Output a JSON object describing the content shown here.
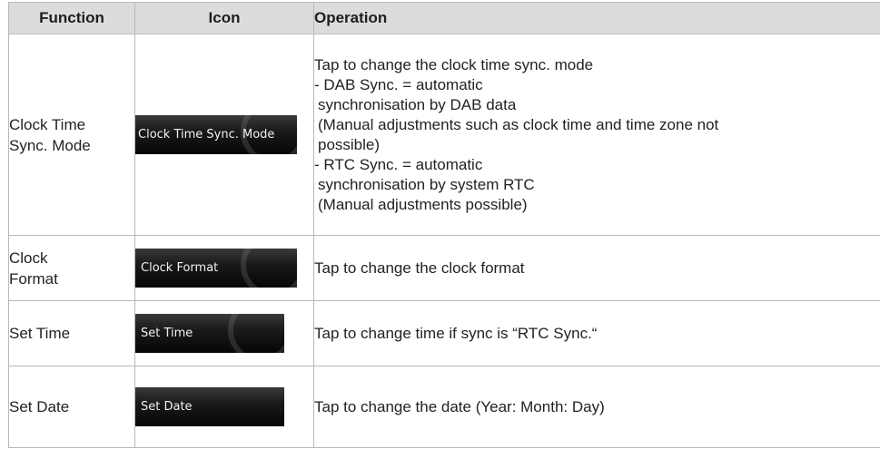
{
  "table": {
    "headers": {
      "function": "Function",
      "icon": "Icon",
      "operation": "Operation"
    },
    "rows": [
      {
        "function": [
          "Clock Time",
          "Sync. Mode"
        ],
        "icon_label": "Clock Time Sync. Mode",
        "operation": [
          "Tap to change the clock time sync. mode",
          "- DAB Sync. = automatic",
          "  synchronisation by DAB data",
          "  (Manual adjustments such as clock time and time zone not",
          "  possible)",
          "- RTC Sync. = automatic",
          "  synchronisation by system RTC",
          "  (Manual adjustments possible)"
        ]
      },
      {
        "function": [
          "Clock",
          "Format"
        ],
        "icon_label": "Clock Format",
        "operation": [
          "Tap to change the clock format"
        ]
      },
      {
        "function": [
          "Set Time"
        ],
        "icon_label": "Set Time",
        "operation": [
          "Tap to change time if sync is “RTC Sync.“"
        ]
      },
      {
        "function": [
          "Set Date"
        ],
        "icon_label": "Set Date",
        "operation": [
          "Tap to change the date (Year: Month: Day)"
        ]
      }
    ]
  }
}
